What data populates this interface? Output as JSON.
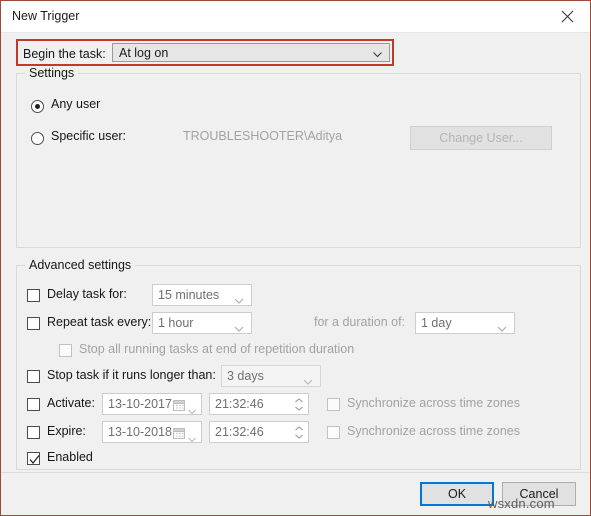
{
  "window": {
    "title": "New Trigger",
    "close_icon": "close-icon",
    "border_color": "#9b4a3c",
    "background": "#f0f0f0"
  },
  "highlight": {
    "color": "#c0392b",
    "target": "begin-the-task-row"
  },
  "begin": {
    "label": "Begin the task:",
    "value": "At log on",
    "arrow_icon": "chevron-down-icon"
  },
  "settings": {
    "title": "Settings",
    "any_user": {
      "label": "Any user",
      "checked": true
    },
    "specific_user": {
      "label": "Specific user:",
      "checked": false,
      "value": "TROUBLESHOOTER\\Aditya"
    },
    "change_user_button": {
      "label": "Change User...",
      "enabled": false
    }
  },
  "advanced": {
    "title": "Advanced settings",
    "delay_task": {
      "label": "Delay task for:",
      "checked": false,
      "value": "15 minutes",
      "arrow_icon": "chevron-down-icon"
    },
    "repeat_task": {
      "label": "Repeat task every:",
      "checked": false,
      "value": "1 hour",
      "arrow_icon": "chevron-down-icon"
    },
    "duration": {
      "label": "for a duration of:",
      "value": "1 day",
      "arrow_icon": "chevron-down-icon",
      "enabled": false
    },
    "stop_all_running": {
      "label": "Stop all running tasks at end of repetition duration",
      "checked": false,
      "enabled": false
    },
    "stop_task_longer": {
      "label": "Stop task if it runs longer than:",
      "checked": false,
      "value": "3 days",
      "arrow_icon": "chevron-down-icon"
    },
    "activate": {
      "label": "Activate:",
      "checked": false,
      "date": "13-10-2017",
      "time": "21:32:46",
      "calendar_icon": "calendar-icon",
      "sync_label": "Synchronize across time zones",
      "sync_checked": false,
      "sync_enabled": false
    },
    "expire": {
      "label": "Expire:",
      "checked": false,
      "date": "13-10-2018",
      "time": "21:32:46",
      "calendar_icon": "calendar-icon",
      "sync_label": "Synchronize across time zones",
      "sync_checked": false,
      "sync_enabled": false
    },
    "enabled": {
      "label": "Enabled",
      "checked": true
    }
  },
  "footer": {
    "ok_label": "OK",
    "cancel_label": "Cancel",
    "focused_button": "OK"
  },
  "watermark": {
    "text": "wsxdn.com"
  }
}
